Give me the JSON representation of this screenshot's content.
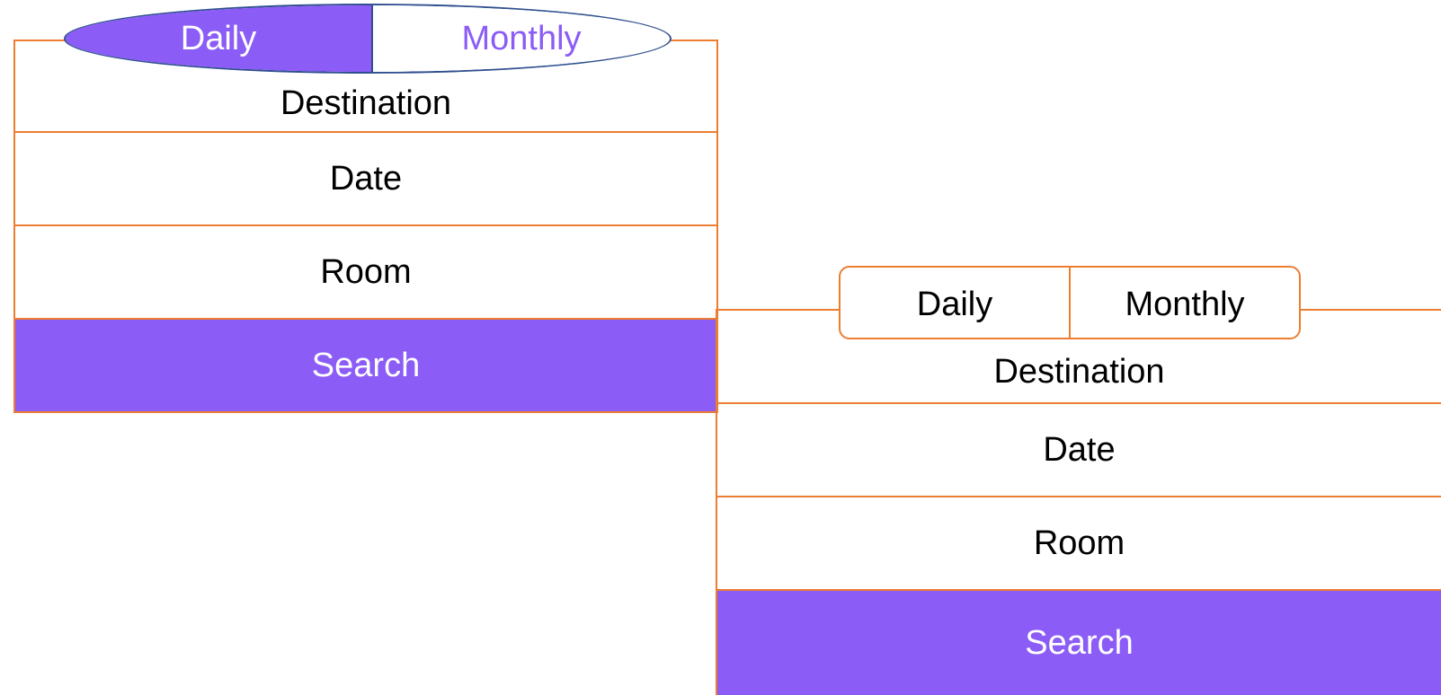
{
  "colors": {
    "accent": "#8B5CF6",
    "border": "#ED7D31",
    "pill_outline": "#2F4F8F",
    "text": "#000000",
    "text_on_accent": "#FFFFFF"
  },
  "variant_a": {
    "toggle": {
      "daily": "Daily",
      "monthly": "Monthly",
      "selected": "Daily"
    },
    "fields": {
      "destination": "Destination",
      "date": "Date",
      "room": "Room"
    },
    "search_label": "Search"
  },
  "variant_b": {
    "toggle": {
      "daily": "Daily",
      "monthly": "Monthly"
    },
    "fields": {
      "destination": "Destination",
      "date": "Date",
      "room": "Room"
    },
    "search_label": "Search"
  }
}
